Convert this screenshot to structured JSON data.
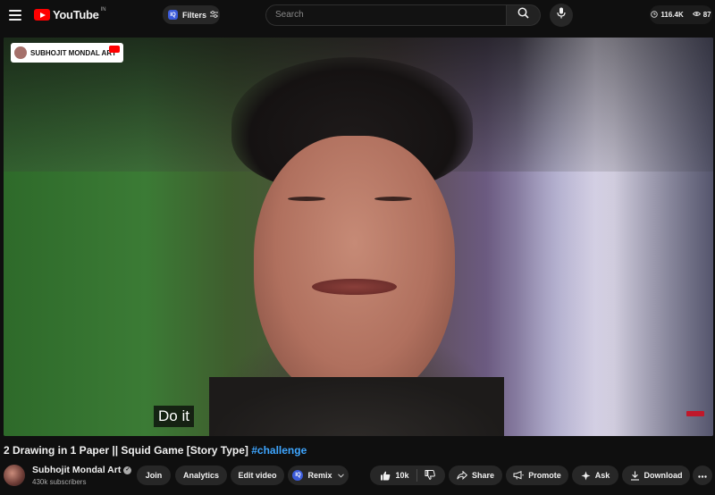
{
  "header": {
    "logo_text": "YouTube",
    "logo_country": "IN",
    "filters_badge": "IQ",
    "filters_label": "Filters",
    "search_placeholder": "Search",
    "views_stat": "116.4K",
    "likes_stat": "87"
  },
  "player": {
    "channel_watermark": "SUBHOJIT MONDAL ART",
    "caption": "Do it"
  },
  "video": {
    "title": "2 Drawing in 1 Paper || Squid Game [Story Type]",
    "title_tag": "#challenge"
  },
  "channel": {
    "name": "Subhojit Mondal Art",
    "subscribers": "430k subscribers"
  },
  "actions": {
    "join": "Join",
    "analytics": "Analytics",
    "edit_video": "Edit video",
    "remix_badge": "IQ",
    "remix": "Remix",
    "likes": "10k",
    "share": "Share",
    "promote": "Promote",
    "ask": "Ask",
    "download": "Download"
  },
  "colors": {
    "background": "#0f0f0f",
    "brand_red": "#ff0000",
    "link_blue": "#3ea6ff",
    "pill_bg": "#272727"
  }
}
